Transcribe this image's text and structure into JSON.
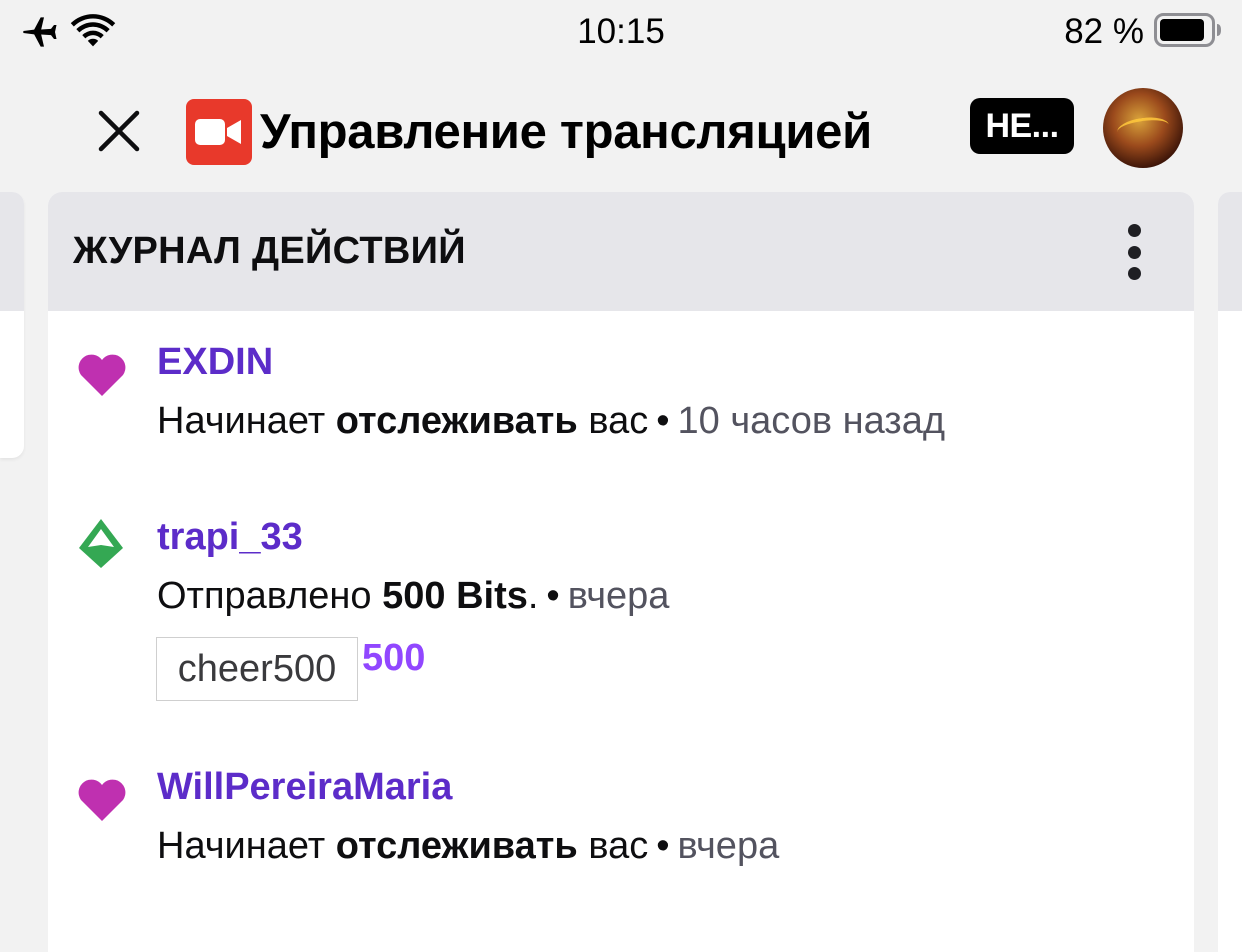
{
  "status_bar": {
    "time": "10:15",
    "battery_text": "82 %",
    "icons": [
      "airplane-icon",
      "wifi-icon",
      "battery-icon"
    ]
  },
  "header": {
    "title": "Управление трансляцией",
    "badge": "НЕ...",
    "icons": [
      "close-icon",
      "camera-icon",
      "avatar"
    ]
  },
  "panel": {
    "title": "ЖУРНАЛ ДЕЙСТВИЙ",
    "more_icon": "more-vertical-icon"
  },
  "activity": [
    {
      "type": "follow",
      "icon": "heart-icon",
      "username": "EXDIN",
      "text_before": "Начинает ",
      "text_bold": "отслеживать",
      "text_after": " вас",
      "separator": "•",
      "time": "10 часов назад"
    },
    {
      "type": "bits",
      "icon": "bits-gem-icon",
      "username": "trapi_33",
      "text_before": "Отправлено ",
      "text_bold": "500 Bits",
      "text_after": ".",
      "separator": "•",
      "time": "вчера",
      "cheer_text": "cheer500",
      "cheer_amount": "500"
    },
    {
      "type": "follow",
      "icon": "heart-icon",
      "username": "WillPereiraMaria",
      "text_before": "Начинает ",
      "text_bold": "отслеживать",
      "text_after": " вас",
      "separator": "•",
      "time": "вчера"
    }
  ],
  "colors": {
    "username": "#5c2cc9",
    "heart": "#bf30b0",
    "bits_gem": "#34a853",
    "cheer_amount": "#9147ff",
    "camera_bg": "#e8392b",
    "panel_header_bg": "#e6e6ea"
  }
}
